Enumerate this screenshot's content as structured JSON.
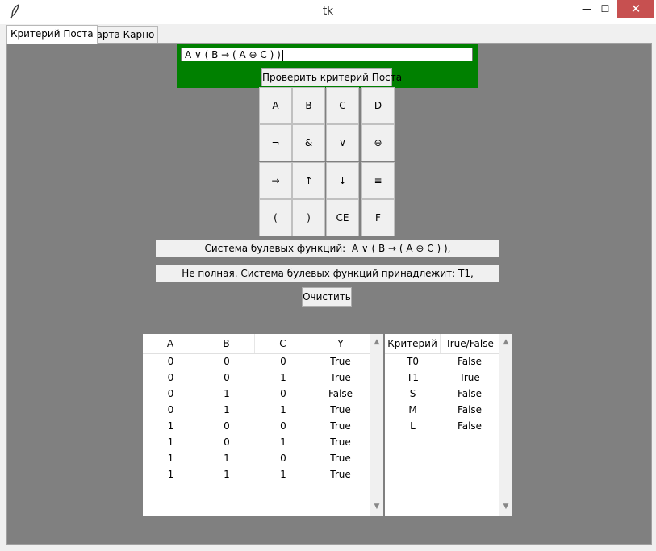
{
  "window": {
    "title": "tk",
    "icon": "feather-icon",
    "minimize": "—",
    "maximize": "☐",
    "close": "✕"
  },
  "tabs": [
    {
      "label": "Критерий Поста",
      "active": true
    },
    {
      "label": "Карта Карно",
      "active": false
    }
  ],
  "expression_input": {
    "value": "A ∨ ( B → ( A ⊕ C ) )"
  },
  "check_button": {
    "label": "Проверить критерий Поста"
  },
  "keypad": [
    [
      "A",
      "B",
      "C",
      "D"
    ],
    [
      "¬",
      "&",
      "∨",
      "⊕"
    ],
    [
      "→",
      "↑",
      "↓",
      "≡"
    ],
    [
      "(",
      ")",
      "CE",
      "F"
    ]
  ],
  "system_label": "Система булевых функций:  A ∨ ( B → ( A ⊕ C ) ),",
  "result_label": "Не полная. Система булевых функций принадлежит: T1,",
  "clear_button": {
    "label": "Очистить"
  },
  "truth_table": {
    "columns": [
      "A",
      "B",
      "C",
      "Y"
    ],
    "rows": [
      [
        "0",
        "0",
        "0",
        "True"
      ],
      [
        "0",
        "0",
        "1",
        "True"
      ],
      [
        "0",
        "1",
        "0",
        "False"
      ],
      [
        "0",
        "1",
        "1",
        "True"
      ],
      [
        "1",
        "0",
        "0",
        "True"
      ],
      [
        "1",
        "0",
        "1",
        "True"
      ],
      [
        "1",
        "1",
        "0",
        "True"
      ],
      [
        "1",
        "1",
        "1",
        "True"
      ]
    ]
  },
  "criteria_table": {
    "columns": [
      "Критерий",
      "True/False"
    ],
    "rows": [
      [
        "T0",
        "False"
      ],
      [
        "T1",
        "True"
      ],
      [
        "S",
        "False"
      ],
      [
        "M",
        "False"
      ],
      [
        "L",
        "False"
      ]
    ]
  },
  "colors": {
    "panel_bg": "#808080",
    "input_frame": "#008000",
    "close_button": "#c75050"
  }
}
